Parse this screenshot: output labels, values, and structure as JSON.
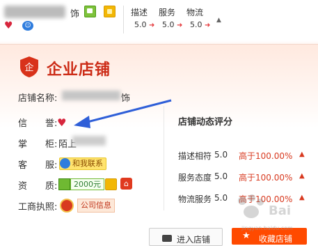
{
  "header": {
    "shop_name_suffix": "饰",
    "ratings": [
      {
        "label": "描述",
        "score": "5.0"
      },
      {
        "label": "服务",
        "score": "5.0"
      },
      {
        "label": "物流",
        "score": "5.0"
      }
    ]
  },
  "card": {
    "shop_type": "企业店铺",
    "shop_name_label": "店铺名称:",
    "shop_name_suffix": "饰",
    "credit_label": "信　　誉:",
    "keeper_label": "掌　　柜:",
    "keeper_value": "陌上",
    "service_label": "客　　服:",
    "contact_text": "和我联系",
    "qual_label": "资　　质:",
    "deposit_amount": "2000元",
    "biz_license_label": "工商执照:",
    "company_info": "公司信息",
    "shield_text": "企"
  },
  "dynamic": {
    "title": "店铺动态评分",
    "rows": [
      {
        "label": "描述相符",
        "score": "5.0",
        "compare": "高于100.00%"
      },
      {
        "label": "服务态度",
        "score": "5.0",
        "compare": "高于100.00%"
      },
      {
        "label": "物流服务",
        "score": "5.0",
        "compare": "高于100.00%"
      }
    ]
  },
  "buttons": {
    "enter_shop": "进入店铺",
    "favorite_shop": "收藏店铺"
  },
  "watermark": {
    "url": "jingyan.baidu.com"
  },
  "colors": {
    "accent": "#cc2b16",
    "favorite": "#ff4a00",
    "arrow": "#2f5fd8"
  }
}
